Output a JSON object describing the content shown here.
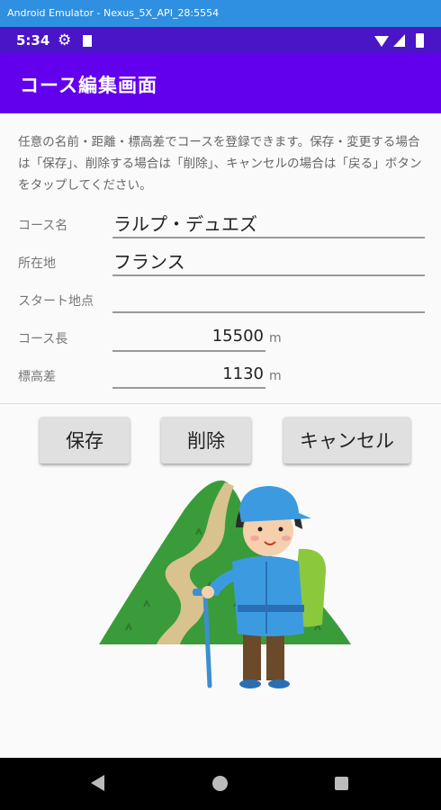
{
  "emulator": {
    "title": "Android Emulator - Nexus_5X_API_28:5554"
  },
  "status_bar": {
    "time": "5:34",
    "icons": [
      "gear-icon",
      "sd-card-icon",
      "wifi-icon",
      "signal-icon",
      "battery-icon"
    ]
  },
  "app_bar": {
    "title": "コース編集画面"
  },
  "description": "任意の名前・距離・標高差でコースを登録できます。保存・変更する場合は「保存」、削除する場合は「削除」、キャンセルの場合は「戻る」ボタンをタップしてください。",
  "form": {
    "course_name": {
      "label": "コース名",
      "value": "ラルプ・デュエズ"
    },
    "location": {
      "label": "所在地",
      "value": "フランス"
    },
    "start_point": {
      "label": "スタート地点",
      "value": ""
    },
    "course_length": {
      "label": "コース長",
      "value": "15500",
      "unit": "m"
    },
    "elevation": {
      "label": "標高差",
      "value": "1130",
      "unit": "m"
    }
  },
  "buttons": {
    "save": "保存",
    "delete": "削除",
    "cancel": "キャンセル"
  },
  "colors": {
    "primary": "#6200ee",
    "primary_dark": "#4a14c7",
    "emulator_bar": "#2f8fe0",
    "button": "#e0e0e0"
  }
}
